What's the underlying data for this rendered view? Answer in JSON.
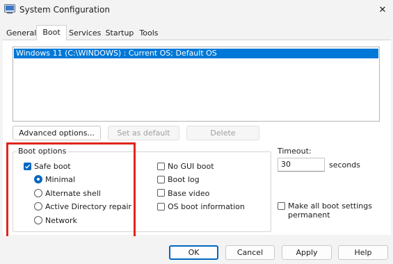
{
  "window": {
    "title": "System Configuration",
    "close_glyph": "✕"
  },
  "tabs": [
    {
      "label": "General",
      "active": false
    },
    {
      "label": "Boot",
      "active": true
    },
    {
      "label": "Services",
      "active": false
    },
    {
      "label": "Startup",
      "active": false
    },
    {
      "label": "Tools",
      "active": false
    }
  ],
  "os_list": {
    "items": [
      "Windows 11 (C:\\WINDOWS) : Current OS; Default OS"
    ],
    "selected_index": 0
  },
  "buttons": {
    "advanced": "Advanced options...",
    "set_default": "Set as default",
    "delete": "Delete"
  },
  "boot_options": {
    "label": "Boot options",
    "safe_boot": {
      "label": "Safe boot",
      "checked": true
    },
    "radios": [
      {
        "label": "Minimal",
        "checked": true
      },
      {
        "label": "Alternate shell",
        "checked": false
      },
      {
        "label": "Active Directory repair",
        "checked": false
      },
      {
        "label": "Network",
        "checked": false
      }
    ],
    "right_checks": [
      {
        "label": "No GUI boot",
        "checked": false
      },
      {
        "label": "Boot log",
        "checked": false
      },
      {
        "label": "Base video",
        "checked": false
      },
      {
        "label": "OS boot information",
        "checked": false
      }
    ]
  },
  "timeout": {
    "label": "Timeout:",
    "value": "30",
    "unit": "seconds"
  },
  "make_permanent": {
    "label_line1": "Make all boot settings",
    "label_line2": "permanent",
    "checked": false
  },
  "footer": {
    "ok": "OK",
    "cancel": "Cancel",
    "apply": "Apply",
    "help": "Help"
  },
  "colors": {
    "accent": "#0067c0",
    "selection": "#0078d7",
    "highlight_box": "#e0241b"
  }
}
